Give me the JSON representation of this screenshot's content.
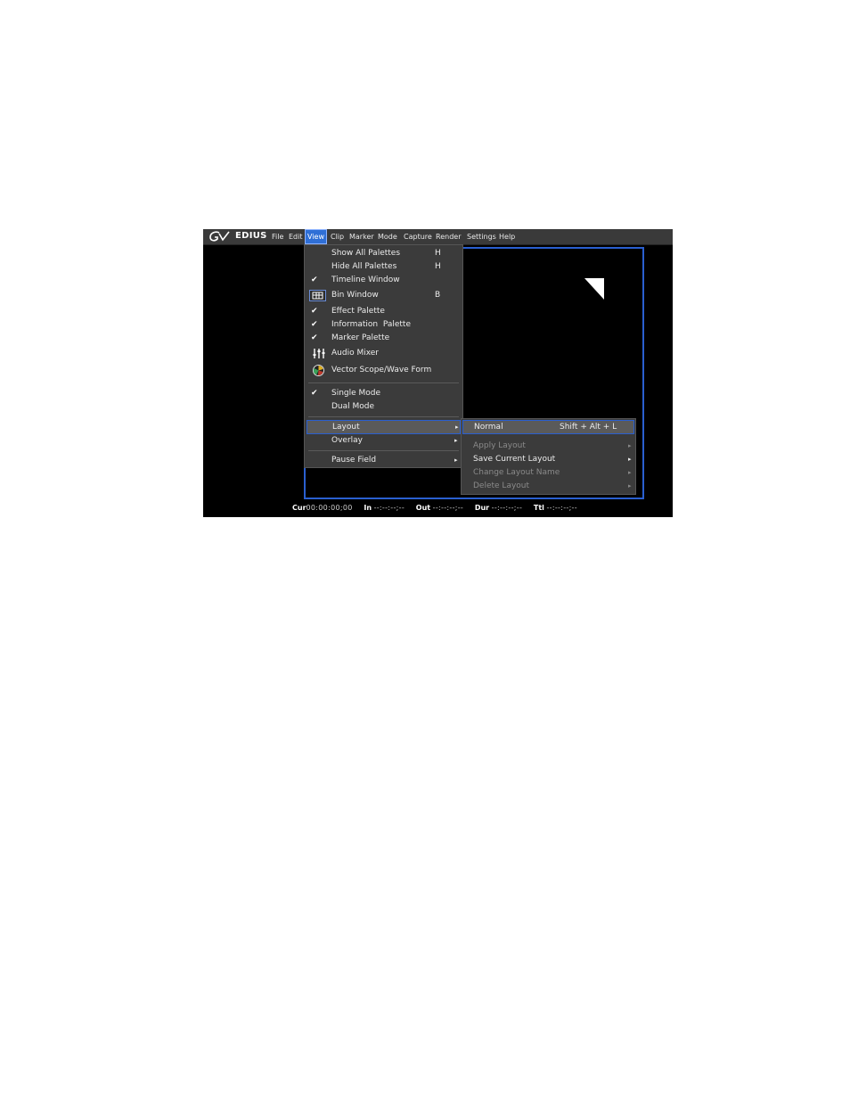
{
  "app": {
    "name": "EDIUS"
  },
  "menubar": {
    "items": [
      "File",
      "Edit",
      "View",
      "Clip",
      "Marker",
      "Mode",
      "Capture",
      "Render",
      "Settings",
      "Help"
    ],
    "active": "View"
  },
  "view_menu": {
    "items": [
      {
        "label": "Show All Palettes",
        "shortcut": "H",
        "checked": false
      },
      {
        "label": "Hide All Palettes",
        "shortcut": "H",
        "checked": false
      },
      {
        "label": "Timeline Window",
        "shortcut": "",
        "checked": true
      },
      {
        "label": "Bin Window",
        "shortcut": "B",
        "checked": false,
        "icon": "bin-window-icon"
      },
      {
        "label": "Effect Palette",
        "shortcut": "",
        "checked": true
      },
      {
        "label": "Information  Palette",
        "shortcut": "",
        "checked": true
      },
      {
        "label": "Marker Palette",
        "shortcut": "",
        "checked": true
      },
      {
        "label": "Audio Mixer",
        "shortcut": "",
        "checked": false,
        "icon": "audio-mixer-icon"
      },
      {
        "label": "Vector Scope/Wave Form",
        "shortcut": "",
        "checked": false,
        "icon": "vector-scope-icon"
      },
      {
        "label": "Single Mode",
        "shortcut": "",
        "checked": true
      },
      {
        "label": "Dual Mode",
        "shortcut": "",
        "checked": false
      },
      {
        "label": "Layout",
        "shortcut": "",
        "checked": false,
        "submenu": true
      },
      {
        "label": "Overlay",
        "shortcut": "",
        "checked": false,
        "submenu": true
      },
      {
        "label": "Pause Field",
        "shortcut": "",
        "checked": false,
        "submenu": true
      }
    ]
  },
  "layout_submenu": {
    "items": [
      {
        "label": "Normal",
        "shortcut": "Shift + Alt + L",
        "enabled": true
      },
      {
        "label": "Apply Layout",
        "enabled": false,
        "submenu": true
      },
      {
        "label": "Save Current Layout",
        "enabled": true,
        "submenu": true
      },
      {
        "label": "Change Layout Name",
        "enabled": false,
        "submenu": true
      },
      {
        "label": "Delete Layout",
        "enabled": false,
        "submenu": true
      }
    ]
  },
  "status": {
    "cur_label": "Cur",
    "cur_value": "00:00:00;00",
    "in_label": "In",
    "in_value": "--:--:--;--",
    "out_label": "Out",
    "out_value": "--:--:--;--",
    "dur_label": "Dur",
    "dur_value": "--:--:--;--",
    "ttl_label": "Ttl",
    "ttl_value": "--:--:--;--"
  },
  "colors": {
    "accent": "#2f6fd6",
    "menu_bg": "#3b3b3b",
    "highlight": "#5a5a5a"
  },
  "icons": {
    "check": "✔",
    "submenu_arrow": "▸"
  }
}
